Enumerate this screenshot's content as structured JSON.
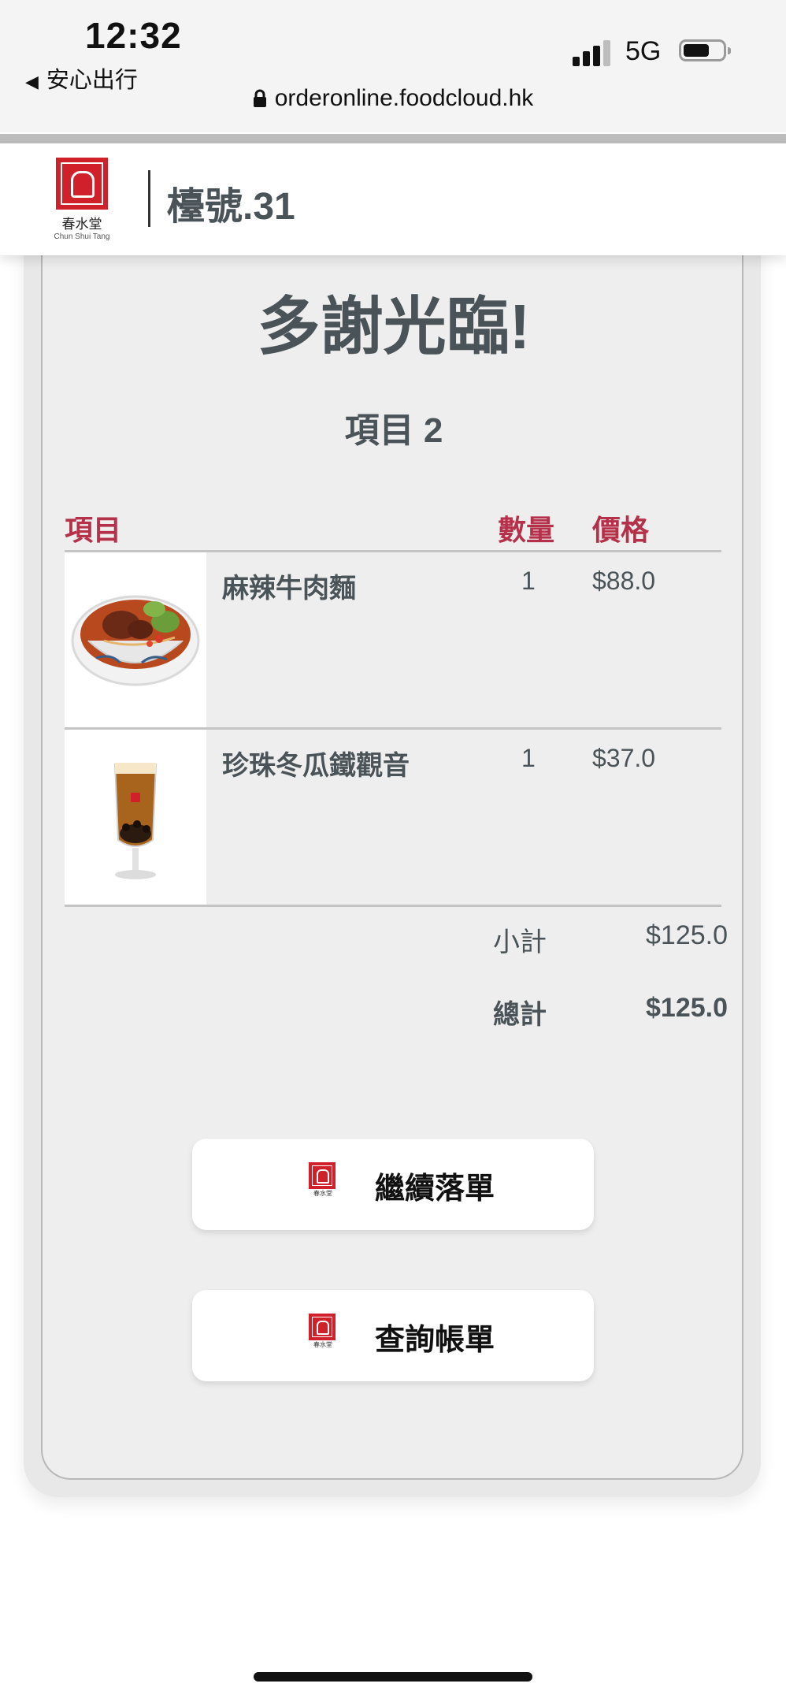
{
  "status_bar": {
    "time": "12:32",
    "back_app": "安心出行",
    "network": "5G",
    "url": "orderonline.foodcloud.hk",
    "signal_icon": "cellular-signal-icon",
    "battery_icon": "battery-icon"
  },
  "header": {
    "logo_text_cn": "春水堂",
    "logo_text_en": "Chun Shui Tang",
    "table": "檯號.31"
  },
  "confirmation": {
    "thanks": "多謝光臨!",
    "items_count": "項目 2"
  },
  "table_headers": {
    "item": "項目",
    "qty": "數量",
    "price": "價格"
  },
  "order_items": [
    {
      "name": "麻辣牛肉麵",
      "qty": "1",
      "price": "$88.0",
      "image": "spicy-beef-noodle-image"
    },
    {
      "name": "珍珠冬瓜鐵觀音",
      "qty": "1",
      "price": "$37.0",
      "image": "pearl-milk-tea-image"
    }
  ],
  "summary": {
    "subtotal_label": "小計",
    "subtotal_value": "$125.0",
    "total_label": "總計",
    "total_value": "$125.0"
  },
  "buttons": {
    "continue_order": "繼續落單",
    "view_bill": "查詢帳單"
  },
  "colors": {
    "accent": "#b5314a",
    "brand_red": "#d0202a",
    "text": "#4a5358"
  }
}
